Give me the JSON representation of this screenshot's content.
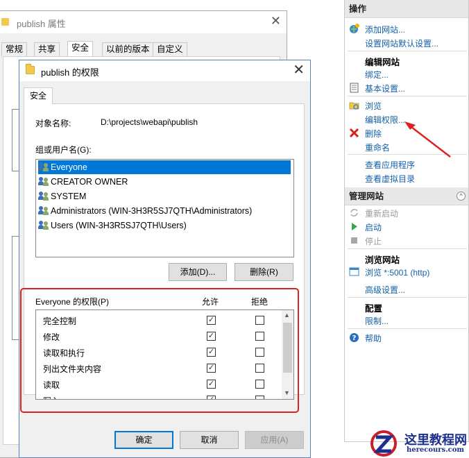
{
  "properties_window": {
    "title": "publish 属性",
    "tabs": [
      "常规",
      "共享",
      "安全",
      "以前的版本",
      "自定义"
    ],
    "active_tab": "安全"
  },
  "permissions_dialog": {
    "title": "publish 的权限",
    "tab": "安全",
    "object_name_label": "对象名称:",
    "object_name_value": "D:\\projects\\webapi\\publish",
    "group_label": "组或用户名(G):",
    "users": [
      "Everyone",
      "CREATOR OWNER",
      "SYSTEM",
      "Administrators (WIN-3H3R5SJ7QTH\\Administrators)",
      "Users (WIN-3H3R5SJ7QTH\\Users)"
    ],
    "selected_user_index": 0,
    "add_button": "添加(D)...",
    "remove_button": "删除(R)",
    "perm_label": "Everyone 的权限(P)",
    "allow_label": "允许",
    "deny_label": "拒绝",
    "permissions": [
      {
        "name": "完全控制",
        "allow": true,
        "deny": false
      },
      {
        "name": "修改",
        "allow": true,
        "deny": false
      },
      {
        "name": "读取和执行",
        "allow": true,
        "deny": false
      },
      {
        "name": "列出文件夹内容",
        "allow": true,
        "deny": false
      },
      {
        "name": "读取",
        "allow": true,
        "deny": false
      },
      {
        "name": "写入",
        "allow": true,
        "deny": false
      }
    ],
    "ok_button": "确定",
    "cancel_button": "取消",
    "apply_button": "应用(A)"
  },
  "actions_pane": {
    "header": "操作",
    "items": [
      {
        "label": "添加网站...",
        "kind": "link",
        "icon": "add-site-icon"
      },
      {
        "label": "设置网站默认设置...",
        "kind": "link"
      },
      {
        "label": "编辑网站",
        "kind": "head"
      },
      {
        "label": "绑定...",
        "kind": "link"
      },
      {
        "label": "基本设置...",
        "kind": "link",
        "icon": "settings-page-icon"
      },
      {
        "label": "浏览",
        "kind": "link",
        "icon": "explore-folder-icon"
      },
      {
        "label": "编辑权限...",
        "kind": "link"
      },
      {
        "label": "删除",
        "kind": "link",
        "icon": "delete-x-icon"
      },
      {
        "label": "重命名",
        "kind": "link"
      },
      {
        "label": "查看应用程序",
        "kind": "link"
      },
      {
        "label": "查看虚拟目录",
        "kind": "link"
      }
    ],
    "manage_header": "管理网站",
    "manage_items": [
      {
        "label": "重新启动",
        "kind": "disabled",
        "icon": "restart-icon"
      },
      {
        "label": "启动",
        "kind": "link",
        "icon": "start-play-icon"
      },
      {
        "label": "停止",
        "kind": "disabled",
        "icon": "stop-square-icon"
      }
    ],
    "browse_header": "浏览网站",
    "browse_items": [
      {
        "label": "浏览 *:5001 (http)",
        "kind": "link",
        "icon": "browse-page-icon"
      },
      {
        "label": "高级设置...",
        "kind": "link"
      }
    ],
    "config_header": "配置",
    "config_items": [
      {
        "label": "限制...",
        "kind": "link"
      }
    ],
    "help": "帮助"
  },
  "watermark": {
    "line1": "这里教程网",
    "line2": "herecours.com"
  },
  "colors": {
    "selection": "#0078d7",
    "link": "#1460aa",
    "highlight_red": "#e02020"
  }
}
